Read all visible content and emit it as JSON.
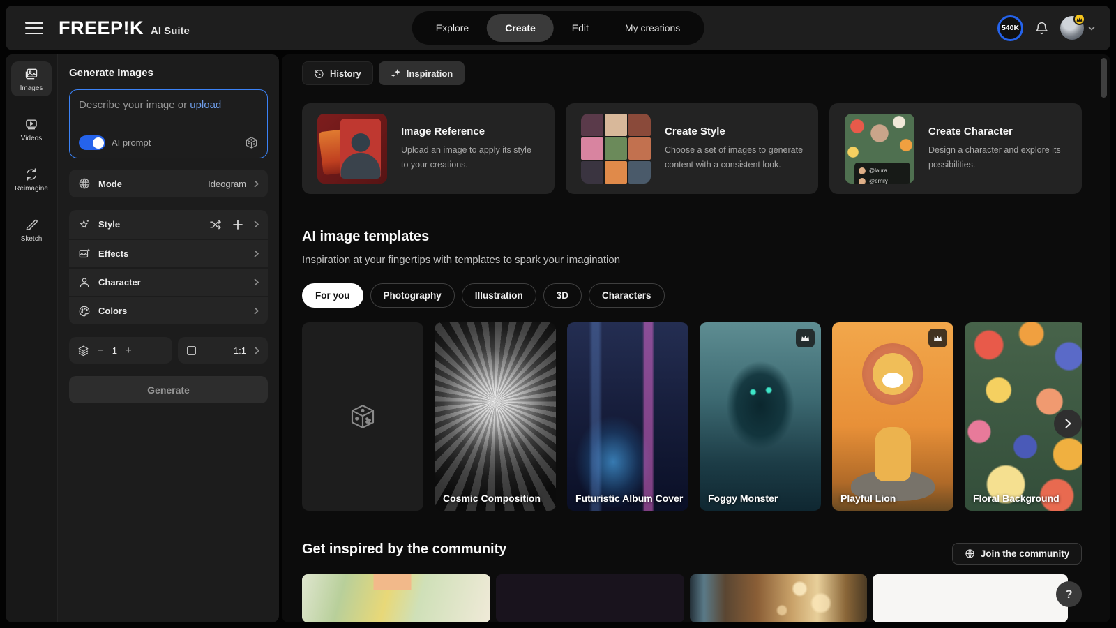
{
  "colors": {
    "accent_blue": "#2563eb",
    "link_blue": "#6d9ce8",
    "premium_yellow": "#f5c51d",
    "panel_bg": "#1c1c1c",
    "main_bg": "#0c0c0c"
  },
  "topbar": {
    "logo": "FREEP!K",
    "suite_label": "AI Suite",
    "nav": [
      {
        "label": "Explore",
        "active": false
      },
      {
        "label": "Create",
        "active": true
      },
      {
        "label": "Edit",
        "active": false
      },
      {
        "label": "My creations",
        "active": false
      }
    ],
    "credits_badge": "540K"
  },
  "rail": {
    "items": [
      {
        "label": "Images",
        "icon": "images-icon",
        "active": true
      },
      {
        "label": "Videos",
        "icon": "videos-icon",
        "active": false
      },
      {
        "label": "Reimagine",
        "icon": "reimagine-icon",
        "active": false
      },
      {
        "label": "Sketch",
        "icon": "sketch-icon",
        "active": false
      }
    ]
  },
  "generator": {
    "title": "Generate Images",
    "prompt": {
      "value": "",
      "placeholder": "Describe your image or",
      "upload_link": "upload",
      "ai_prompt_label": "AI prompt",
      "ai_prompt_on": true
    },
    "mode_row": {
      "label": "Mode",
      "value": "Ideogram"
    },
    "option_rows": [
      {
        "label": "Style"
      },
      {
        "label": "Effects"
      },
      {
        "label": "Character"
      },
      {
        "label": "Colors"
      }
    ],
    "image_count": "1",
    "aspect_ratio": "1:1",
    "generate_label": "Generate"
  },
  "content": {
    "toolbar": {
      "history_label": "History",
      "inspiration_label": "Inspiration",
      "active": "Inspiration"
    },
    "feature_cards": [
      {
        "title": "Image Reference",
        "description": "Upload an image to apply its style to your creations."
      },
      {
        "title": "Create Style",
        "description": "Choose a set of images to generate content with a consistent look."
      },
      {
        "title": "Create Character",
        "description": "Design a character and explore its possibilities.",
        "overlay_handles": [
          "@laura",
          "@emily"
        ]
      }
    ],
    "templates": {
      "title": "AI image templates",
      "subtitle": "Inspiration at your fingertips with templates to spark your imagination",
      "filters": [
        "For you",
        "Photography",
        "Illustration",
        "3D",
        "Characters"
      ],
      "active_filter": "For you",
      "cards": [
        {
          "label": "",
          "premium": false,
          "kind": "random-prompt"
        },
        {
          "label": "Cosmic Composition",
          "premium": false
        },
        {
          "label": "Futuristic Album Cover",
          "premium": false
        },
        {
          "label": "Foggy Monster",
          "premium": true
        },
        {
          "label": "Playful Lion",
          "premium": true
        },
        {
          "label": "Floral Background",
          "premium": false
        }
      ]
    },
    "community": {
      "title": "Get inspired by the community",
      "join_label": "Join the community"
    }
  },
  "help": {
    "label": "?"
  }
}
